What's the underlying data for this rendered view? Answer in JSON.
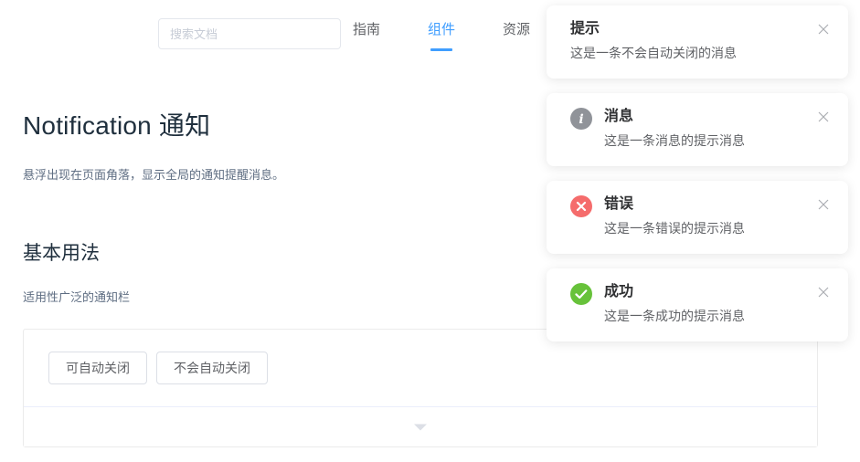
{
  "header": {
    "search": {
      "placeholder": "搜索文档",
      "value": ""
    },
    "nav": [
      {
        "label": "指南",
        "active": false
      },
      {
        "label": "组件",
        "active": true
      },
      {
        "label": "资源",
        "active": false
      }
    ]
  },
  "doc": {
    "title": "Notification 通知",
    "description": "悬浮出现在页面角落，显示全局的通知提醒消息。",
    "section_title": "基本用法",
    "section_desc": "适用性广泛的通知栏",
    "buttons": [
      {
        "label": "可自动关闭"
      },
      {
        "label": "不会自动关闭"
      }
    ],
    "expand_icon": "chevron-down-icon"
  },
  "notifications": [
    {
      "type": "plain",
      "icon": "none",
      "icon_color": "",
      "title": "提示",
      "message": "这是一条不会自动关闭的消息",
      "close_icon": "close-icon"
    },
    {
      "type": "info",
      "icon": "info-icon",
      "icon_color": "#909399",
      "title": "消息",
      "message": "这是一条消息的提示消息",
      "close_icon": "close-icon"
    },
    {
      "type": "error",
      "icon": "error-icon",
      "icon_color": "#f56c6c",
      "title": "错误",
      "message": "这是一条错误的提示消息",
      "close_icon": "close-icon"
    },
    {
      "type": "success",
      "icon": "success-icon",
      "icon_color": "#67c23a",
      "title": "成功",
      "message": "这是一条成功的提示消息",
      "close_icon": "close-icon"
    }
  ],
  "colors": {
    "accent": "#409eff",
    "title": "#1f2f3d",
    "text": "#5e6d82",
    "border": "#ebebeb",
    "info": "#909399",
    "error": "#f56c6c",
    "success": "#67c23a"
  }
}
